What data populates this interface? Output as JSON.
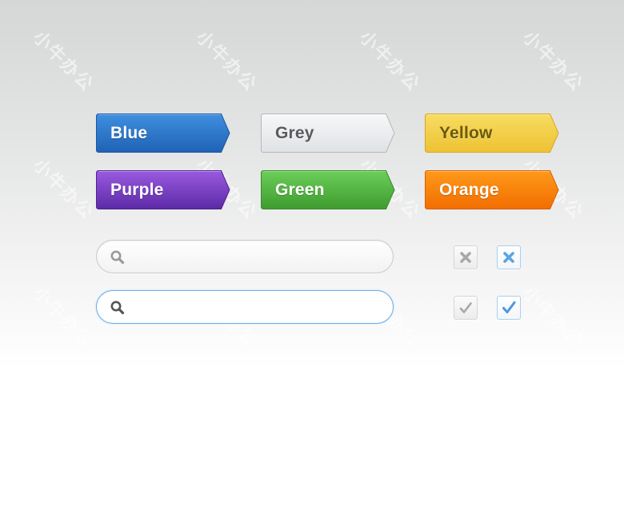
{
  "watermark": "小牛办公",
  "tags": [
    {
      "label": "Blue",
      "color_top": "#3f8fe0",
      "color_bottom": "#1f62b5",
      "border": "#1a56a3",
      "text_color": "#ffffff"
    },
    {
      "label": "Grey",
      "color_top": "#f7f8f9",
      "color_bottom": "#dfe2e5",
      "border": "#b5b8bb",
      "text_color": "#5a5b5c"
    },
    {
      "label": "Yellow",
      "color_top": "#f8dc62",
      "color_bottom": "#eec232",
      "border": "#d3a920",
      "text_color": "#6b5a0c"
    },
    {
      "label": "Purple",
      "color_top": "#9a5ae0",
      "color_bottom": "#5c2aa6",
      "border": "#4e2290",
      "text_color": "#ffffff"
    },
    {
      "label": "Green",
      "color_top": "#6dce5a",
      "color_bottom": "#3e9c2f",
      "border": "#37892a",
      "text_color": "#ffffff"
    },
    {
      "label": "Orange",
      "color_top": "#ff9a1a",
      "color_bottom": "#f26d00",
      "border": "#d86000",
      "text_color": "#ffffff"
    }
  ],
  "search_fields": [
    {
      "state": "normal",
      "value": "",
      "placeholder": "",
      "icon": "search-icon",
      "icon_color": "#9a9a9a"
    },
    {
      "state": "focused",
      "value": "",
      "placeholder": "",
      "icon": "search-icon",
      "icon_color": "#555555"
    }
  ],
  "checkboxes": [
    {
      "kind": "cross",
      "state": "unchecked",
      "icon_color": "#a8a8a8"
    },
    {
      "kind": "cross",
      "state": "checked",
      "icon_color": "#5aa4e4"
    },
    {
      "kind": "check",
      "state": "unchecked",
      "icon_color": "#a8a8a8"
    },
    {
      "kind": "check",
      "state": "checked",
      "icon_color": "#4a98e0"
    }
  ]
}
